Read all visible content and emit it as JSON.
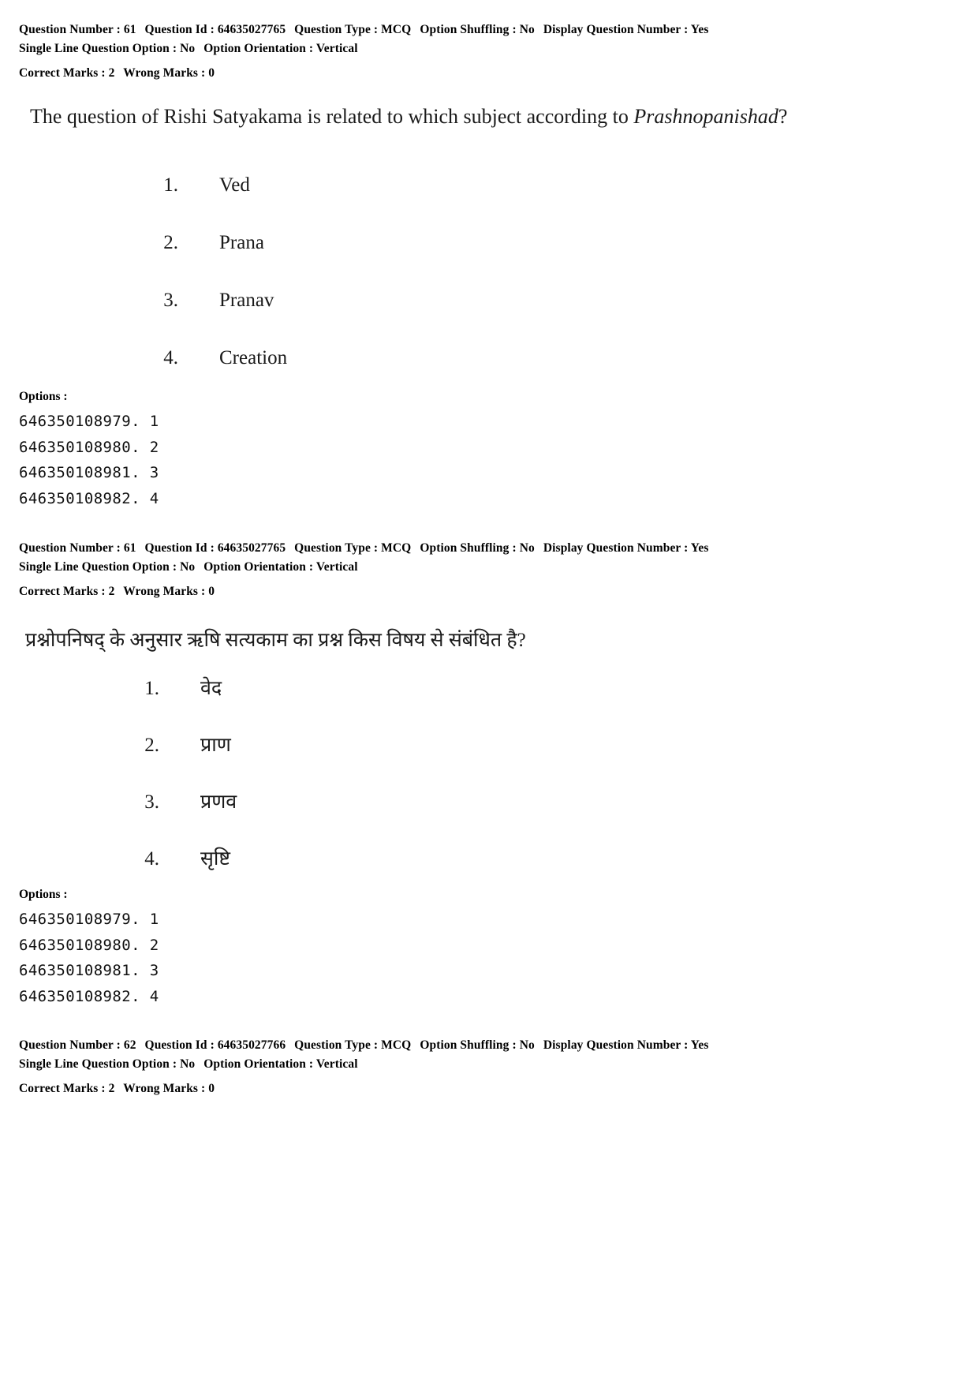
{
  "page": {
    "background": "#ffffff",
    "text_color": "#111111"
  },
  "blocks": [
    {
      "id": "meta-q61-en",
      "question_number_label": "Question Number :",
      "question_number": "61",
      "question_id_label": "Question Id :",
      "question_id": "64635027765",
      "question_type_label": "Question Type :",
      "question_type": "MCQ",
      "option_shuffling_label": "Option Shuffling :",
      "option_shuffling": "No",
      "display_question_number_label": "Display Question Number :",
      "display_question_number": "Yes",
      "single_line_question_option_label": "Single Line Question Option :",
      "single_line_question_option": "No",
      "option_orientation_label": "Option Orientation :",
      "option_orientation": "Vertical",
      "correct_marks_label": "Correct Marks :",
      "correct_marks": "2",
      "wrong_marks_label": "Wrong Marks :",
      "wrong_marks": "0"
    },
    {
      "id": "meta-q61-hi",
      "question_number_label": "Question Number :",
      "question_number": "61",
      "question_id_label": "Question Id :",
      "question_id": "64635027765",
      "question_type_label": "Question Type :",
      "question_type": "MCQ",
      "option_shuffling_label": "Option Shuffling :",
      "option_shuffling": "No",
      "display_question_number_label": "Display Question Number :",
      "display_question_number": "Yes",
      "single_line_question_option_label": "Single Line Question Option :",
      "single_line_question_option": "No",
      "option_orientation_label": "Option Orientation :",
      "option_orientation": "Vertical",
      "correct_marks_label": "Correct Marks :",
      "correct_marks": "2",
      "wrong_marks_label": "Wrong Marks :",
      "wrong_marks": "0"
    },
    {
      "id": "meta-q62-en",
      "question_number_label": "Question Number :",
      "question_number": "62",
      "question_id_label": "Question Id :",
      "question_id": "64635027766",
      "question_type_label": "Question Type :",
      "question_type": "MCQ",
      "option_shuffling_label": "Option Shuffling :",
      "option_shuffling": "No",
      "display_question_number_label": "Display Question Number :",
      "display_question_number": "Yes",
      "single_line_question_option_label": "Single Line Question Option :",
      "single_line_question_option": "No",
      "option_orientation_label": "Option Orientation :",
      "option_orientation": "Vertical",
      "correct_marks_label": "Correct Marks :",
      "correct_marks": "2",
      "wrong_marks_label": "Wrong Marks :",
      "wrong_marks": "0"
    }
  ],
  "question_en": {
    "stem_part1": "The question of Rishi Satyakama is related to which subject according to ",
    "stem_italic": "Prashnopanishad",
    "stem_part2": "?",
    "choices": [
      {
        "num": "1.",
        "text": "Ved"
      },
      {
        "num": "2.",
        "text": "Prana"
      },
      {
        "num": "3.",
        "text": "Pranav"
      },
      {
        "num": "4.",
        "text": "Creation"
      }
    ],
    "options_title": "Options :",
    "option_ids": [
      "646350108979. 1",
      "646350108980. 2",
      "646350108981. 3",
      "646350108982. 4"
    ]
  },
  "question_hi": {
    "stem": "प्रश्नोपनिषद् के अनुसार ऋषि सत्यकाम का प्रश्न किस विषय से संबंधित है?",
    "choices": [
      {
        "num": "1.",
        "text": "वेद"
      },
      {
        "num": "2.",
        "text": "प्राण"
      },
      {
        "num": "3.",
        "text": "प्रणव"
      },
      {
        "num": "4.",
        "text": "सृष्टि"
      }
    ],
    "options_title": "Options :",
    "option_ids": [
      "646350108979. 1",
      "646350108980. 2",
      "646350108981. 3",
      "646350108982. 4"
    ]
  }
}
